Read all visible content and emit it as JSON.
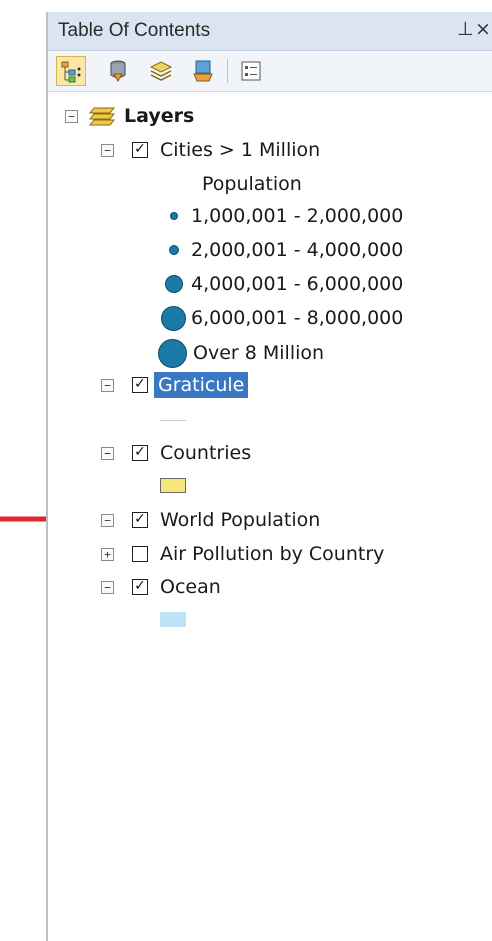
{
  "window": {
    "title": "Table Of Contents",
    "pin_glyph": "⊥",
    "close_glyph": "×"
  },
  "toolbar": {
    "buttons": [
      {
        "name": "list-by-drawing-order",
        "icon": "tree-list-icon",
        "active": true
      },
      {
        "name": "list-by-source",
        "icon": "database-icon"
      },
      {
        "name": "list-by-visibility",
        "icon": "layers-icon"
      },
      {
        "name": "list-by-selection",
        "icon": "selection-icon"
      },
      {
        "name": "options",
        "icon": "options-icon"
      }
    ]
  },
  "tree": {
    "root_label": "Layers",
    "cities": {
      "label": "Cities > 1 Million",
      "legend_heading": "Population",
      "classes": [
        "1,000,001 - 2,000,000",
        "2,000,001 - 4,000,000",
        "4,000,001 - 6,000,000",
        "6,000,001 - 8,000,000",
        "Over 8 Million"
      ]
    },
    "graticule": {
      "label": "Graticule"
    },
    "countries": {
      "label": "Countries"
    },
    "world_population": {
      "label": "World Population"
    },
    "air_pollution": {
      "label": "Air Pollution by Country"
    },
    "ocean": {
      "label": "Ocean"
    }
  },
  "colors": {
    "city_symbol": "#1c7aa6",
    "countries_fill": "#f5e87a",
    "ocean_fill": "#bfe4f5",
    "selection": "#3b78c4",
    "arrow": "#e0262b"
  }
}
